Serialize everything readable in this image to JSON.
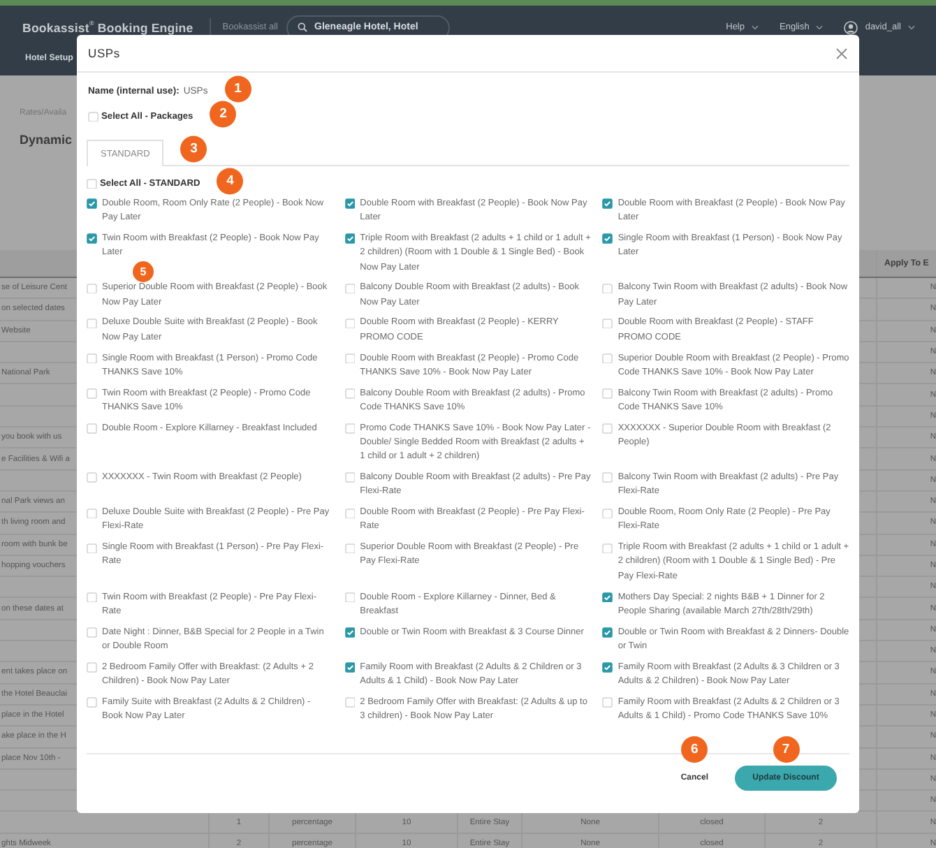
{
  "header": {
    "brand": "Bookassist$^{®}$ Booking Engine",
    "account": "Bookassist all",
    "hotel_search": {
      "value": "Gleneagle Hotel, Hotel"
    },
    "menus": [
      {
        "label": "Help"
      },
      {
        "label": "English"
      }
    ],
    "user": {
      "name": "david_all"
    }
  },
  "nav": [
    {
      "label": "Hotel Setup"
    }
  ],
  "breadcrumb": "Rates/Availa",
  "page_title": "Dynamic",
  "table": {
    "apply_header": "Apply To E",
    "rows": [
      {
        "name": "se of Leisure Cent",
        "apply": "N"
      },
      {
        "name": "on selected dates",
        "apply": "N"
      },
      {
        "name": "Website",
        "apply": "N"
      },
      {
        "apply": "N"
      },
      {
        "name": "National Park",
        "apply": "N"
      },
      {
        "apply": "N"
      },
      {
        "apply": "N"
      },
      {
        "name": "you book with us",
        "apply": "N"
      },
      {
        "name": "e Facilities & Wifi a",
        "apply": "N"
      },
      {
        "apply": "N"
      },
      {
        "name": "nal Park views an",
        "apply": "N"
      },
      {
        "name": "th living room and",
        "apply": "N"
      },
      {
        "name": "room with bunk be",
        "apply": "N"
      },
      {
        "name": "hopping vouchers",
        "apply": "N"
      },
      {
        "apply": "N"
      },
      {
        "name": "on these dates at",
        "apply": "N"
      },
      {
        "apply": "N"
      },
      {
        "apply": "N"
      },
      {
        "name": "ent takes place on",
        "apply": "N"
      },
      {
        "name": "the Hotel Beauclai",
        "apply": "N"
      },
      {
        "name": "place in the Hotel",
        "apply": "N"
      },
      {
        "name": "ake place in the H",
        "apply": "N"
      },
      {
        "name": "place Nov 10th -",
        "apply": "N"
      },
      {
        "apply": "N"
      },
      {
        "apply": "N"
      },
      {
        "cells": [
          "1",
          "percentage",
          "10",
          "Entire Stay",
          "None",
          "closed",
          "2"
        ],
        "apply": "N"
      },
      {
        "name": "ghts Midweek",
        "cells": [
          "2",
          "percentage",
          "10",
          "Entire Stay",
          "None",
          "closed",
          "2"
        ],
        "apply": "N"
      }
    ]
  },
  "dialog": {
    "title": "USPs",
    "name_field": {
      "label": "Name (internal use):",
      "value": "USPs",
      "marker": "1"
    },
    "select_all_packages": {
      "label": "Select All - Packages",
      "checked": false,
      "marker": "2"
    },
    "tabs": [
      {
        "label": "STANDARD",
        "selected": true,
        "marker": "3"
      }
    ],
    "select_all_standard": {
      "label": "Select All - STANDARD",
      "checked": false,
      "marker": "4"
    },
    "options": [
      {
        "label": "Double Room, Room Only Rate (2 People) - Book Now Pay Later",
        "checked": true
      },
      {
        "label": "Double Room with Breakfast (2 People) - Book Now Pay Later",
        "checked": true
      },
      {
        "label": "Double Room with Breakfast (2 People) - Book Now Pay Later",
        "checked": true
      },
      {
        "label": "Twin Room with Breakfast (2 People) - Book Now Pay Later",
        "checked": true,
        "marker": "5"
      },
      {
        "label": "Triple Room with Breakfast (2 adults + 1 child or 1 adult + 2 children) (Room with 1 Double & 1 Single Bed) - Book Now Pay Later",
        "checked": true
      },
      {
        "label": "Single Room with Breakfast (1 Person) - Book Now Pay Later",
        "checked": true
      },
      {
        "label": "Superior Double Room with Breakfast (2 People) - Book Now Pay Later",
        "checked": false
      },
      {
        "label": "Balcony Double Room with Breakfast (2 adults) - Book Now Pay Later",
        "checked": false
      },
      {
        "label": "Balcony Twin Room with Breakfast (2 adults) - Book Now Pay Later",
        "checked": false
      },
      {
        "label": "Deluxe Double Suite with Breakfast (2 People) - Book Now Pay Later",
        "checked": false
      },
      {
        "label": "Double Room with Breakfast (2 People) - KERRY PROMO CODE",
        "checked": false
      },
      {
        "label": "Double Room with Breakfast (2 People) - STAFF PROMO CODE",
        "checked": false
      },
      {
        "label": "Single Room with Breakfast (1 Person) - Promo Code THANKS Save 10%",
        "checked": false
      },
      {
        "label": "Double Room with Breakfast (2 People) - Promo Code THANKS Save 10% - Book Now Pay Later",
        "checked": false
      },
      {
        "label": "Superior Double Room with Breakfast (2 People) - Promo Code THANKS Save 10% - Book Now Pay Later",
        "checked": false
      },
      {
        "label": "Twin Room with Breakfast (2 People) - Promo Code THANKS Save 10%",
        "checked": false
      },
      {
        "label": "Balcony Double Room with Breakfast (2 adults) - Promo Code THANKS Save 10%",
        "checked": false
      },
      {
        "label": "Balcony Twin Room with Breakfast (2 adults) - Promo Code THANKS Save 10%",
        "checked": false
      },
      {
        "label": "Double Room - Explore Killarney - Breakfast Included",
        "checked": false
      },
      {
        "label": "Promo Code THANKS Save 10% - Book Now Pay Later - Double/ Single Bedded Room with Breakfast (2 adults + 1 child or 1 adult + 2 children)",
        "checked": false
      },
      {
        "label": "XXXXXXX - Superior Double Room with Breakfast (2 People)",
        "checked": false
      },
      {
        "label": "XXXXXXX - Twin Room with Breakfast (2 People)",
        "checked": false
      },
      {
        "label": "Balcony Double Room with Breakfast (2 adults) - Pre Pay Flexi-Rate",
        "checked": false
      },
      {
        "label": "Balcony Twin Room with Breakfast (2 adults) - Pre Pay Flexi-Rate",
        "checked": false
      },
      {
        "label": "Deluxe Double Suite with Breakfast (2 People) - Pre Pay Flexi-Rate",
        "checked": false
      },
      {
        "label": "Double Room with Breakfast (2 People) - Pre Pay Flexi-Rate",
        "checked": false
      },
      {
        "label": "Double Room, Room Only Rate (2 People) - Pre Pay Flexi-Rate",
        "checked": false
      },
      {
        "label": "Single Room with Breakfast (1 Person) - Pre Pay Flexi-Rate",
        "checked": false
      },
      {
        "label": "Superior Double Room with Breakfast (2 People) - Pre Pay Flexi-Rate",
        "checked": false
      },
      {
        "label": "Triple Room with Breakfast (2 adults + 1 child or 1 adult + 2 children) (Room with 1 Double & 1 Single Bed) - Pre Pay Flexi-Rate",
        "checked": false
      },
      {
        "label": "Twin Room with Breakfast (2 People) - Pre Pay Flexi-Rate",
        "checked": false
      },
      {
        "label": "Double Room - Explore Killarney - Dinner, Bed & Breakfast",
        "checked": false
      },
      {
        "label": "Mothers Day Special: 2 nights B&B + 1 Dinner for 2 People Sharing (available March 27th/28th/29th)",
        "checked": true
      },
      {
        "label": "Date Night : Dinner, B&B Special for 2 People in a Twin or Double Room",
        "checked": false
      },
      {
        "label": "Double or Twin Room with Breakfast & 3 Course Dinner",
        "checked": true
      },
      {
        "label": "Double or Twin Room with Breakfast & 2 Dinners- Double or Twin",
        "checked": true
      },
      {
        "label": "2 Bedroom Family Offer with Breakfast: (2 Adults + 2 Children) - Book Now Pay Later",
        "checked": false
      },
      {
        "label": "Family Room with Breakfast (2 Adults & 2 Children or 3 Adults & 1 Child) - Book Now Pay Later",
        "checked": true
      },
      {
        "label": "Family Room with Breakfast (2 Adults & 3 Children or 3 Adults & 2 Children) - Book Now Pay Later",
        "checked": true
      },
      {
        "label": "Family Suite with Breakfast (2 Adults & 2 Children) - Book Now Pay Later",
        "checked": false
      },
      {
        "label": "2 Bedroom Family Offer with Breakfast: (2 Adults & up to 3 children) - Book Now Pay Later",
        "checked": false
      },
      {
        "label": "Family Room with Breakfast (2 Adults & 2 Children or 3 Adults & 1 Child) - Promo Code THANKS Save 10%",
        "checked": false
      }
    ],
    "buttons": [
      {
        "kind": "text",
        "label": "Cancel",
        "marker": "6"
      },
      {
        "kind": "primary",
        "label": "Update Discount",
        "marker": "7"
      }
    ]
  }
}
